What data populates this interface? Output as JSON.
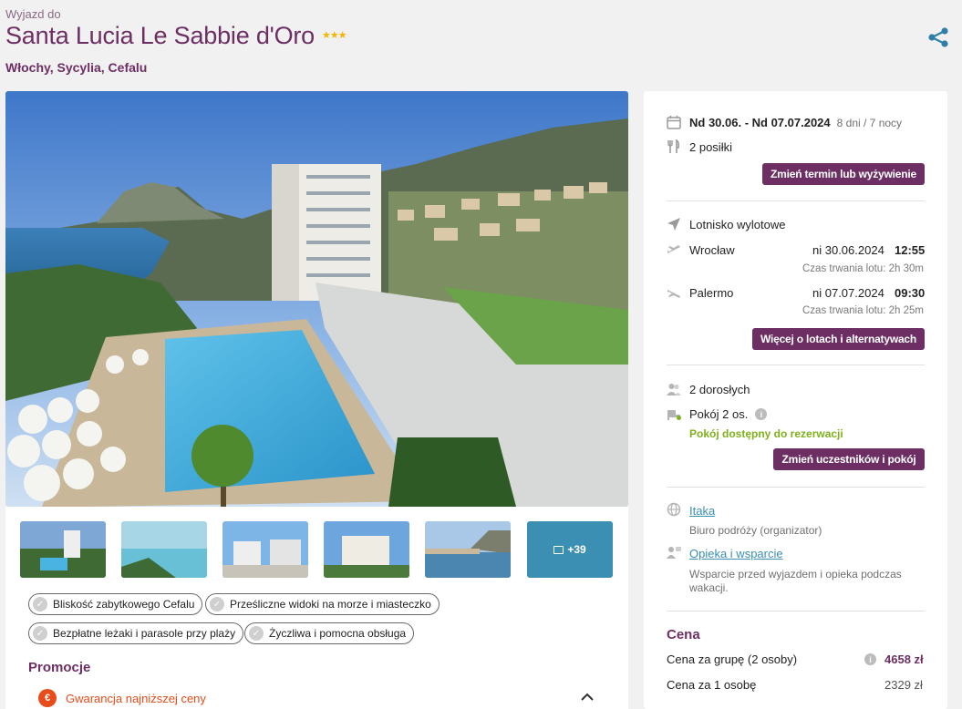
{
  "header": {
    "pre_title": "Wyjazd do",
    "title": "Santa Lucia Le Sabbie d'Oro",
    "stars": "★★★",
    "location": "Włochy, Sycylia, Cefalu"
  },
  "gallery": {
    "more_label": "+39"
  },
  "features": [
    "Bliskość zabytkowego Cefalu",
    "Prześliczne widoki na morze i miasteczko",
    "Bezpłatne leżaki i parasole przy plaży",
    "Życzliwa i pomocna obsługa"
  ],
  "promo": {
    "heading": "Promocje",
    "item": "Gwarancja najniższej ceny"
  },
  "booking": {
    "dates": "Nd 30.06. - Nd 07.07.2024",
    "duration": "8 dni / 7 nocy",
    "meals": "2 posiłki",
    "change_date_btn": "Zmień termin lub wyżywienie",
    "airport_label": "Lotnisko wylotowe",
    "outbound": {
      "city": "Wrocław",
      "date": "ni 30.06.2024",
      "time": "12:55",
      "duration": "Czas trwania lotu: 2h 30m"
    },
    "inbound": {
      "city": "Palermo",
      "date": "ni 07.07.2024",
      "time": "09:30",
      "duration": "Czas trwania lotu: 2h 25m"
    },
    "flights_btn": "Więcej o lotach i alternatywach",
    "adults": "2 dorosłych",
    "room": "Pokój 2 os.",
    "room_status": "Pokój dostępny do rezerwacji",
    "change_people_btn": "Zmień uczestników i pokój",
    "operator_name": "Itaka",
    "operator_desc": "Biuro podróży (organizator)",
    "support_link": "Opieka i wsparcie",
    "support_desc_1": "Wsparcie przed wyjazdem i opieka podczas",
    "support_desc_2": "wakacji."
  },
  "price": {
    "heading": "Cena",
    "group_label": "Cena za grupę (2 osoby)",
    "group_value": "4658 zł",
    "person_label": "Cena za 1 osobę",
    "person_value": "2329 zł"
  },
  "colors": {
    "brand": "#6d2f63",
    "accent_blue": "#3a8fb3",
    "available_green": "#7fb11b",
    "promo_orange": "#e74c1a",
    "star": "#f2b705"
  }
}
